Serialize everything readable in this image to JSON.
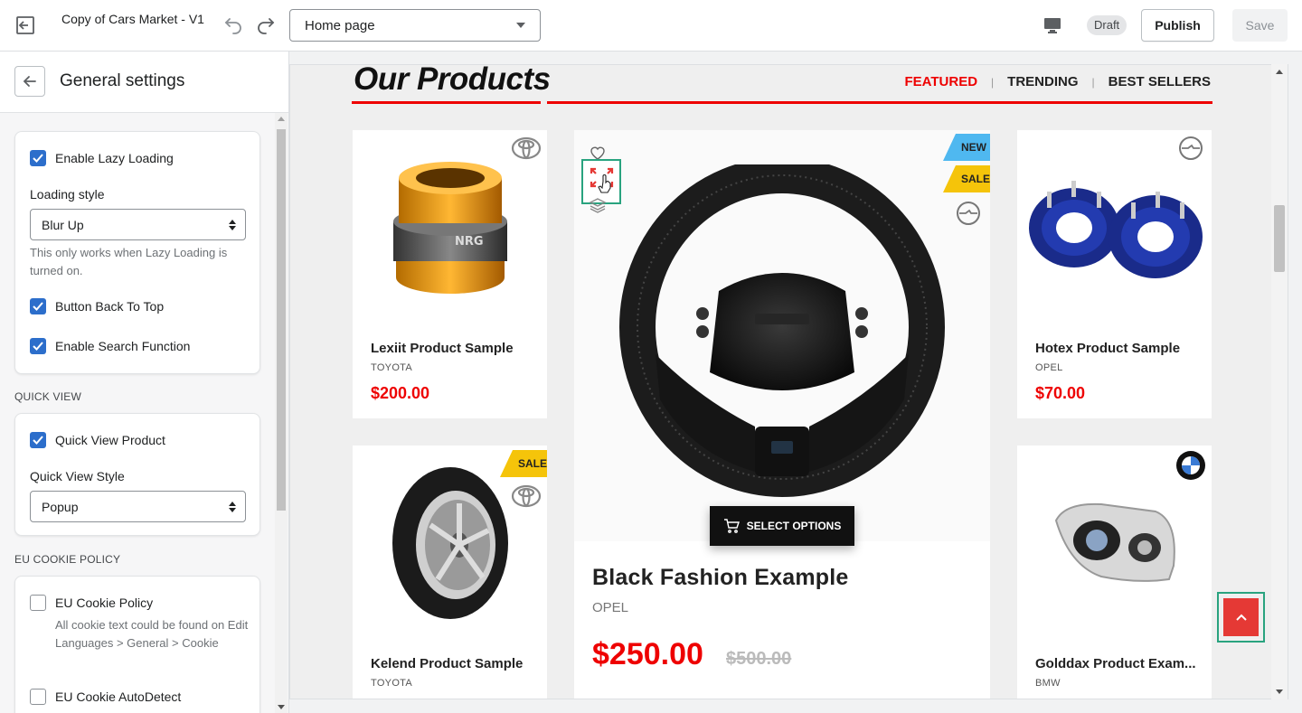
{
  "topbar": {
    "theme_name": "Copy of Cars Market - V1",
    "page_selected": "Home page",
    "status": "Draft",
    "publish_label": "Publish",
    "save_label": "Save"
  },
  "sidebar": {
    "title": "General settings",
    "general": {
      "lazy_loading": {
        "label": "Enable Lazy Loading",
        "checked": true
      },
      "loading_style_label": "Loading style",
      "loading_style_value": "Blur Up",
      "loading_style_help": "This only works when Lazy Loading is turned on.",
      "back_to_top": {
        "label": "Button Back To Top",
        "checked": true
      },
      "search_function": {
        "label": "Enable Search Function",
        "checked": true
      }
    },
    "quick_view": {
      "heading": "QUICK VIEW",
      "quick_view_product": {
        "label": "Quick View Product",
        "checked": true
      },
      "style_label": "Quick View Style",
      "style_value": "Popup"
    },
    "cookie": {
      "heading": "EU COOKIE POLICY",
      "policy": {
        "label": "EU Cookie Policy",
        "checked": false
      },
      "policy_help": "All cookie text could be found on Edit Languages > General > Cookie",
      "autodetect": {
        "label": "EU Cookie AutoDetect",
        "checked": false
      }
    }
  },
  "preview": {
    "section_title": "Our Products",
    "tabs": [
      {
        "label": "FEATURED",
        "active": true
      },
      {
        "label": "TRENDING",
        "active": false
      },
      {
        "label": "BEST SELLERS",
        "active": false
      }
    ],
    "products": [
      {
        "name": "Lexiit Product Sample",
        "brand": "TOYOTA",
        "price": "$200.00",
        "image": "steering-hub-adapter"
      },
      {
        "name": "Hotex Product Sample",
        "brand": "OPEL",
        "price": "$70.00",
        "image": "wheel-spacers"
      },
      {
        "name": "Kelend Product Sample",
        "brand": "TOYOTA",
        "badge": "SALE",
        "image": "tire"
      },
      {
        "name": "Golddax Product Exam...",
        "brand": "BMW",
        "image": "headlight"
      }
    ],
    "featured": {
      "name": "Black Fashion Example",
      "brand": "OPEL",
      "price": "$250.00",
      "old_price": "$500.00",
      "badges": [
        "NEW",
        "SALE"
      ],
      "select_options_label": "SELECT OPTIONS",
      "image": "steering-wheel"
    },
    "colors": {
      "accent_red": "#ee0000",
      "badge_new": "#4fb8f0",
      "badge_sale": "#f5c40a",
      "highlight": "#29a37f"
    }
  }
}
